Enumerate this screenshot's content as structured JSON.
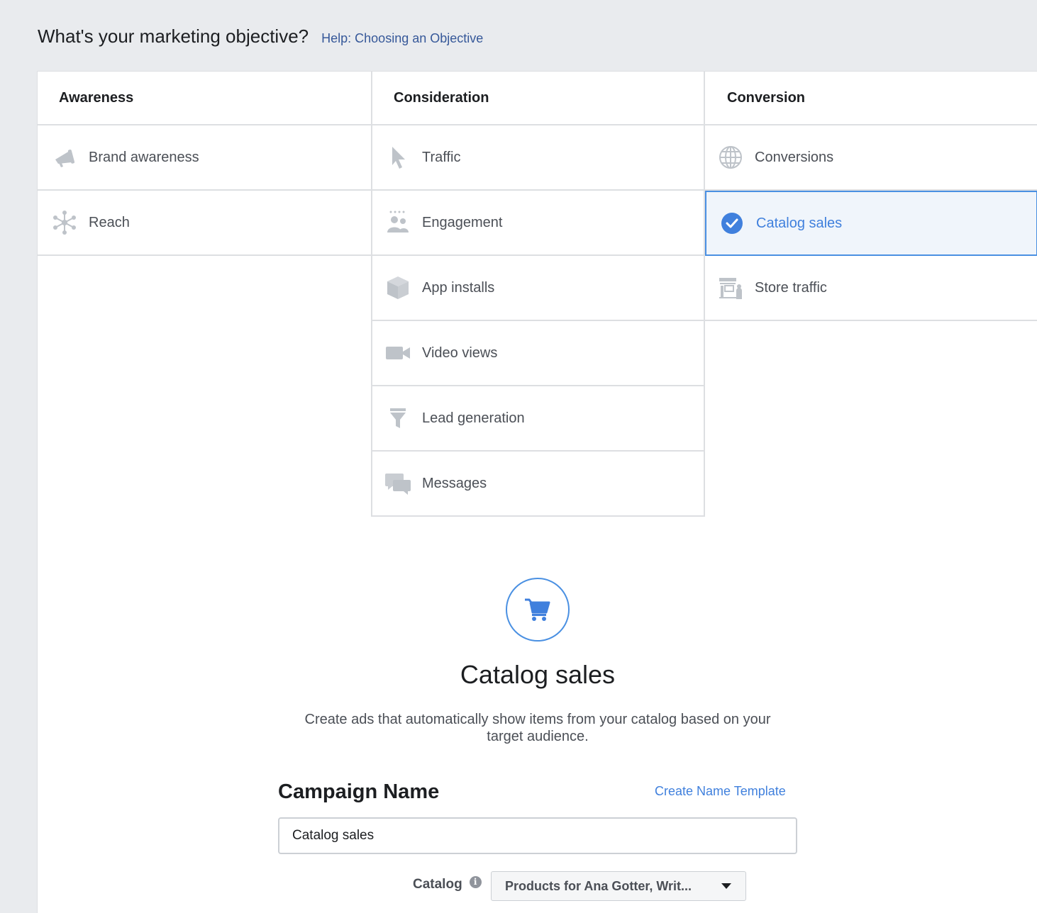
{
  "header": {
    "title": "What's your marketing objective?",
    "help_link": "Help: Choosing an Objective"
  },
  "columns": {
    "awareness": {
      "title": "Awareness",
      "items": [
        {
          "label": "Brand awareness",
          "icon": "megaphone-icon"
        },
        {
          "label": "Reach",
          "icon": "network-icon"
        }
      ]
    },
    "consideration": {
      "title": "Consideration",
      "items": [
        {
          "label": "Traffic",
          "icon": "cursor-icon"
        },
        {
          "label": "Engagement",
          "icon": "people-icon"
        },
        {
          "label": "App installs",
          "icon": "box-icon"
        },
        {
          "label": "Video views",
          "icon": "video-camera-icon"
        },
        {
          "label": "Lead generation",
          "icon": "funnel-icon"
        },
        {
          "label": "Messages",
          "icon": "chat-bubbles-icon"
        }
      ]
    },
    "conversion": {
      "title": "Conversion",
      "items": [
        {
          "label": "Conversions",
          "icon": "globe-icon"
        },
        {
          "label": "Catalog sales",
          "icon": "checkmark-circle-icon",
          "selected": true
        },
        {
          "label": "Store traffic",
          "icon": "storefront-icon"
        }
      ]
    }
  },
  "detail": {
    "icon": "shopping-cart-icon",
    "title": "Catalog sales",
    "description": "Create ads that automatically show items from your catalog based on your target audience."
  },
  "campaign": {
    "label": "Campaign Name",
    "template_link": "Create Name Template",
    "value": "Catalog sales",
    "catalog_label": "Catalog",
    "catalog_value": "Products for Ana Gotter, Writ..."
  },
  "colors": {
    "accent": "#4080dd",
    "selected_bg": "#f0f5fb",
    "icon_gray": "#bec3c9"
  }
}
